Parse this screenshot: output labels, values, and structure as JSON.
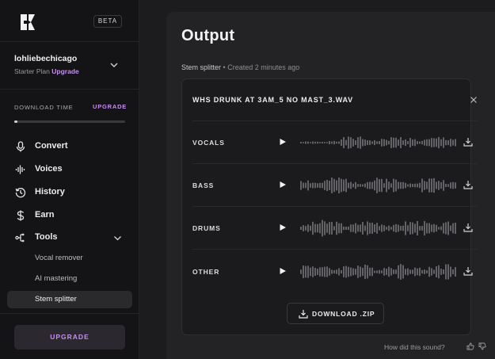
{
  "sidebar": {
    "beta_badge": "BETA",
    "user": {
      "name": "lohliebechicago",
      "plan": "Starter Plan",
      "plan_upgrade": "Upgrade"
    },
    "download_time": {
      "label": "DOWNLOAD TIME",
      "upgrade_label": "UPGRADE",
      "progress": 0.03
    },
    "nav": {
      "convert": "Convert",
      "voices": "Voices",
      "history": "History",
      "earn": "Earn",
      "tools": "Tools"
    },
    "tools_sub": {
      "vocal_remover": "Vocal remover",
      "ai_mastering": "AI mastering",
      "stem_splitter": "Stem splitter"
    },
    "upgrade_button": "UPGRADE"
  },
  "main": {
    "title": "Output",
    "meta_tool": "Stem splitter",
    "meta_separator": "•",
    "meta_created": "Created 2 minutes ago",
    "file_name": "WHS DRUNK AT 3AM_5 NO MAST_3.WAV",
    "stems": [
      {
        "name": "VOCALS"
      },
      {
        "name": "BASS"
      },
      {
        "name": "DRUMS"
      },
      {
        "name": "OTHER"
      }
    ],
    "download_zip": "DOWNLOAD .ZIP",
    "feedback_prompt": "How did this sound?"
  },
  "icons": {
    "logo": "logo-icon",
    "play": "play-icon",
    "download": "download-icon",
    "close": "close-icon",
    "chevron": "chevron-down-icon",
    "thumbs_up": "thumbs-up-icon",
    "thumbs_down": "thumbs-down-icon"
  },
  "colors": {
    "accent": "#c58ef0",
    "background": "#1c1c1e",
    "sidebar": "#141416",
    "card": "#1b1b1d"
  }
}
